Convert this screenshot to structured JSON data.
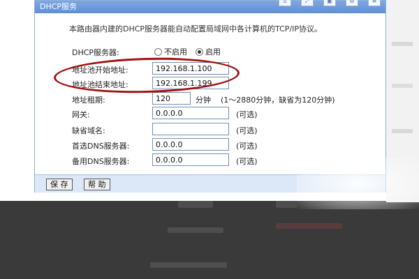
{
  "dialog": {
    "title": "DHCP服务",
    "description": "本路由器内建的DHCP服务器能自动配置局域网中各计算机的TCP/IP协议。"
  },
  "form": {
    "dhcp_server": {
      "label": "DHCP服务器:",
      "options": [
        "不启用",
        "启用"
      ],
      "selected": "启用"
    },
    "pool_start": {
      "label": "地址池开始地址:",
      "value": "192.168.1.100"
    },
    "pool_end": {
      "label": "地址池结束地址:",
      "value": "192.168.1.199"
    },
    "lease": {
      "label": "地址租期:",
      "value": "120",
      "unit": "分钟",
      "hint": "(1～2880分钟，缺省为120分钟)"
    },
    "gateway": {
      "label": "网关:",
      "value": "0.0.0.0",
      "hint": "(可选)"
    },
    "domain": {
      "label": "缺省域名:",
      "value": "",
      "hint": "(可选)"
    },
    "primary_dns": {
      "label": "首选DNS服务器:",
      "value": "0.0.0.0",
      "hint": "(可选)"
    },
    "secondary_dns": {
      "label": "备用DNS服务器:",
      "value": "0.0.0.0",
      "hint": "(可选)"
    }
  },
  "buttons": {
    "save": "保 存",
    "help": "帮 助"
  },
  "colors": {
    "header": "#5e8fd6",
    "footer": "#dce8f7",
    "annotation": "#9e1414"
  }
}
